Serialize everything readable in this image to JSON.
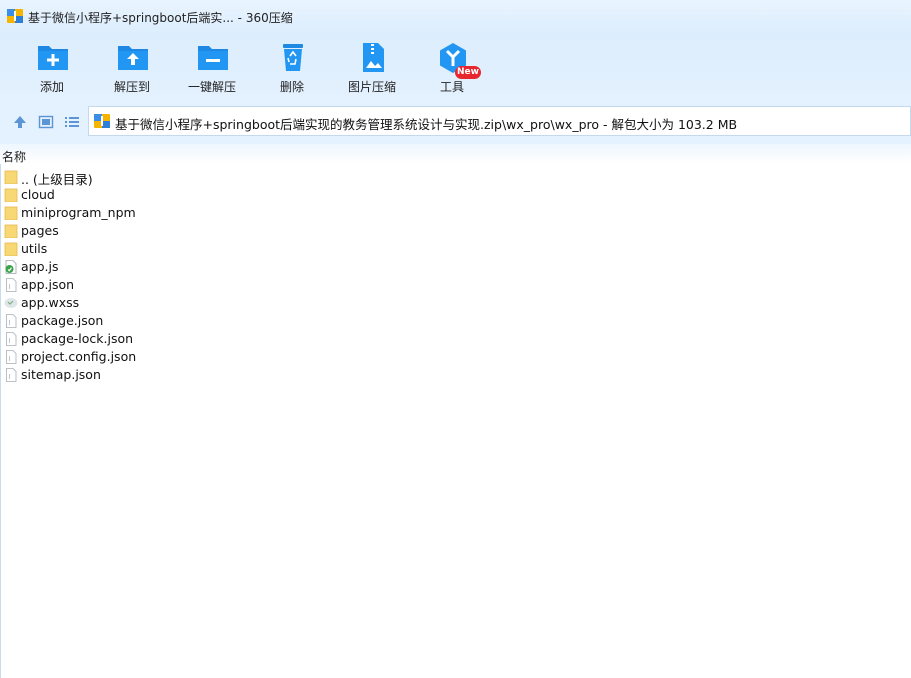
{
  "window": {
    "title": "基于微信小程序+springboot后端实... - 360压缩"
  },
  "toolbar": {
    "add": "添加",
    "extract_to": "解压到",
    "one_click_extract": "一键解压",
    "delete": "删除",
    "image_compress": "图片压缩",
    "tools": "工具",
    "new_badge": "New"
  },
  "address": {
    "path": "基于微信小程序+springboot后端实现的教务管理系统设计与实现.zip\\wx_pro\\wx_pro - 解包大小为 103.2 MB"
  },
  "columns": {
    "name": "名称"
  },
  "files": [
    {
      "name": ".. (上级目录)",
      "icon": "folder-icon"
    },
    {
      "name": "cloud",
      "icon": "folder-icon"
    },
    {
      "name": "miniprogram_npm",
      "icon": "folder-icon"
    },
    {
      "name": "pages",
      "icon": "folder-icon"
    },
    {
      "name": "utils",
      "icon": "folder-icon"
    },
    {
      "name": "app.js",
      "icon": "js-file-icon"
    },
    {
      "name": "app.json",
      "icon": "json-file-icon"
    },
    {
      "name": "app.wxss",
      "icon": "wxss-file-icon"
    },
    {
      "name": "package.json",
      "icon": "json-file-icon"
    },
    {
      "name": "package-lock.json",
      "icon": "json-file-icon"
    },
    {
      "name": "project.config.json",
      "icon": "json-file-icon"
    },
    {
      "name": "sitemap.json",
      "icon": "json-file-icon"
    }
  ]
}
